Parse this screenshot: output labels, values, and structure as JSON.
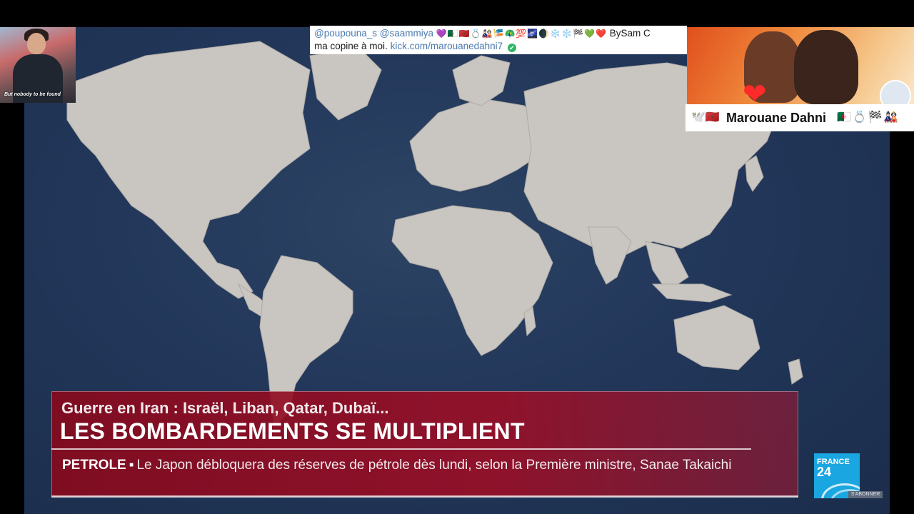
{
  "stream": {
    "left_cam": {
      "caption": "But nobody to be found"
    },
    "chat": {
      "users": [
        "@poupouna_s",
        "@saammiya"
      ],
      "emojis": "💜🇩🇿🇲🇦💍🎎🎏🦚💯🌌🌒❄️❄️🏁💚❤️",
      "by": "BySam C",
      "text": "ma copine à moi.",
      "link": "kick.com/marouanedahni7",
      "verified_icon": "✔"
    },
    "right_cam": {
      "name_prefix": "🕊️🇲🇦",
      "name": "Marouane Dahni",
      "name_suffix": "🇩🇿💍🏁🎎",
      "heart": "❤"
    }
  },
  "broadcast": {
    "lower_third": {
      "subtitle": "Guerre en Iran : Israël, Liban, Qatar, Dubaï...",
      "title": "LES BOMBARDEMENTS SE MULTIPLIENT",
      "ticker_tag": "PETROLE",
      "ticker_bullet": "▪",
      "ticker_text": "Le Japon débloquera des réserves de pétrole dès lundi, selon la Première ministre, Sanae Takaichi"
    },
    "logo": {
      "line1": "FRANCE",
      "line2": "24"
    },
    "subscribe_label": "S'ABONNER"
  },
  "colors": {
    "ocean": "#22375a",
    "land": "#c9c6c1",
    "lower_third_red": "#9b0e26",
    "logo_blue": "#1aa6e0"
  }
}
